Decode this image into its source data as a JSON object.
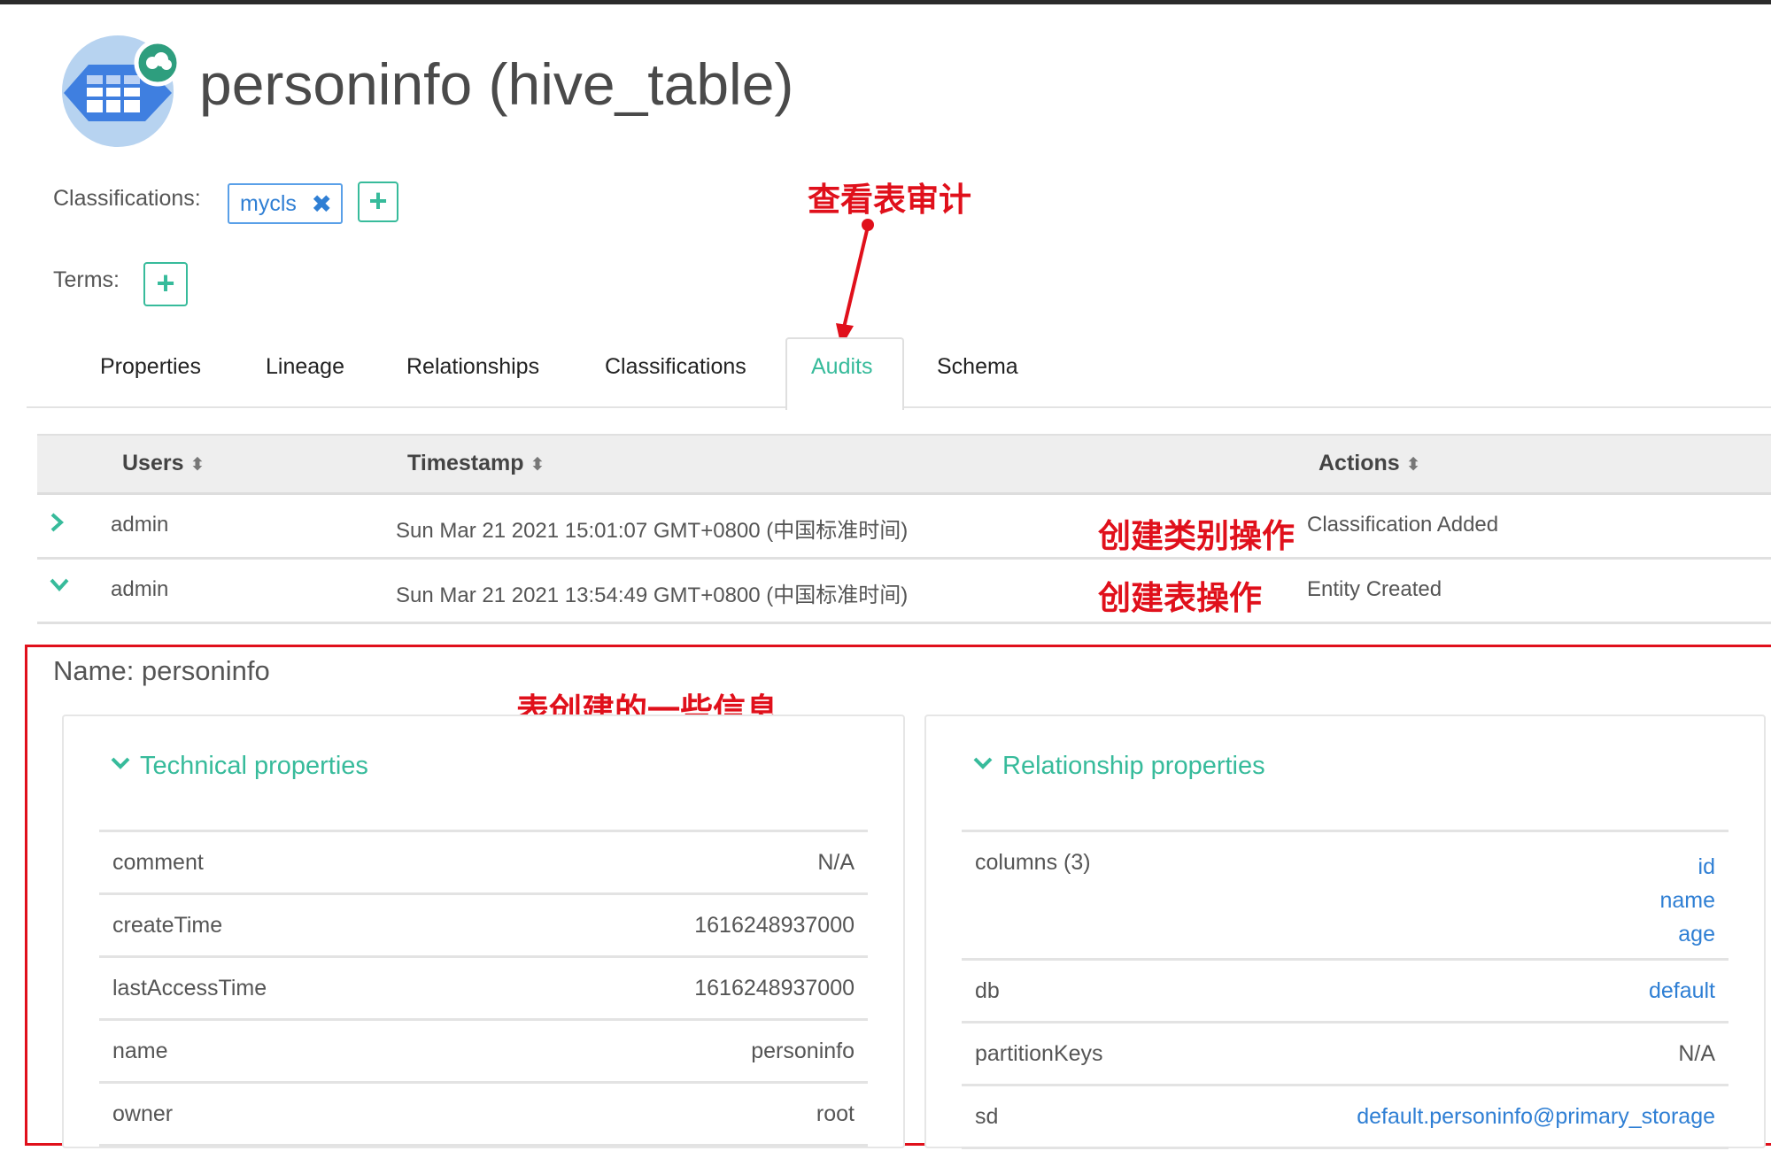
{
  "entity": {
    "title": "personinfo (hive_table)",
    "icon": "hive-table-icon",
    "accent_color": "#37bb9b",
    "link_color": "#2f7fd4"
  },
  "classifications": {
    "label": "Classifications:",
    "tags": [
      {
        "name": "mycls"
      }
    ],
    "remove_icon": "✖",
    "add_icon": "+"
  },
  "terms": {
    "label": "Terms:",
    "add_icon": "+"
  },
  "tabs": [
    {
      "label": "Properties",
      "active": false
    },
    {
      "label": "Lineage",
      "active": false
    },
    {
      "label": "Relationships",
      "active": false
    },
    {
      "label": "Classifications",
      "active": false
    },
    {
      "label": "Audits",
      "active": true
    },
    {
      "label": "Schema",
      "active": false
    }
  ],
  "audit_table": {
    "columns": [
      "Users",
      "Timestamp",
      "Actions"
    ],
    "sort_icon": "⬍",
    "rows": [
      {
        "user": "admin",
        "timestamp": "Sun Mar 21 2021 15:01:07 GMT+0800 (中国标准时间)",
        "action": "Classification Added",
        "expanded": false
      },
      {
        "user": "admin",
        "timestamp": "Sun Mar 21 2021 13:54:49 GMT+0800 (中国标准时间)",
        "action": "Entity Created",
        "expanded": true
      }
    ]
  },
  "annotations": {
    "view_audit": "查看表审计",
    "row1_note": "创建类别操作",
    "row2_note": "创建表操作",
    "detail_note": "表创建的一些信息",
    "color": "#e0101b"
  },
  "detail": {
    "name_line": "Name: personinfo",
    "technical": {
      "title": "Technical properties",
      "rows": [
        {
          "key": "comment",
          "value": "N/A"
        },
        {
          "key": "createTime",
          "value": "1616248937000"
        },
        {
          "key": "lastAccessTime",
          "value": "1616248937000"
        },
        {
          "key": "name",
          "value": "personinfo"
        },
        {
          "key": "owner",
          "value": "root"
        }
      ]
    },
    "relationship": {
      "title": "Relationship properties",
      "columns_key": "columns (3)",
      "columns_values": [
        "id",
        "name",
        "age"
      ],
      "rows": [
        {
          "key": "db",
          "value": "default",
          "link": true
        },
        {
          "key": "partitionKeys",
          "value": "N/A",
          "link": false
        },
        {
          "key": "sd",
          "value": "default.personinfo@primary_storage",
          "link": true
        }
      ]
    }
  }
}
